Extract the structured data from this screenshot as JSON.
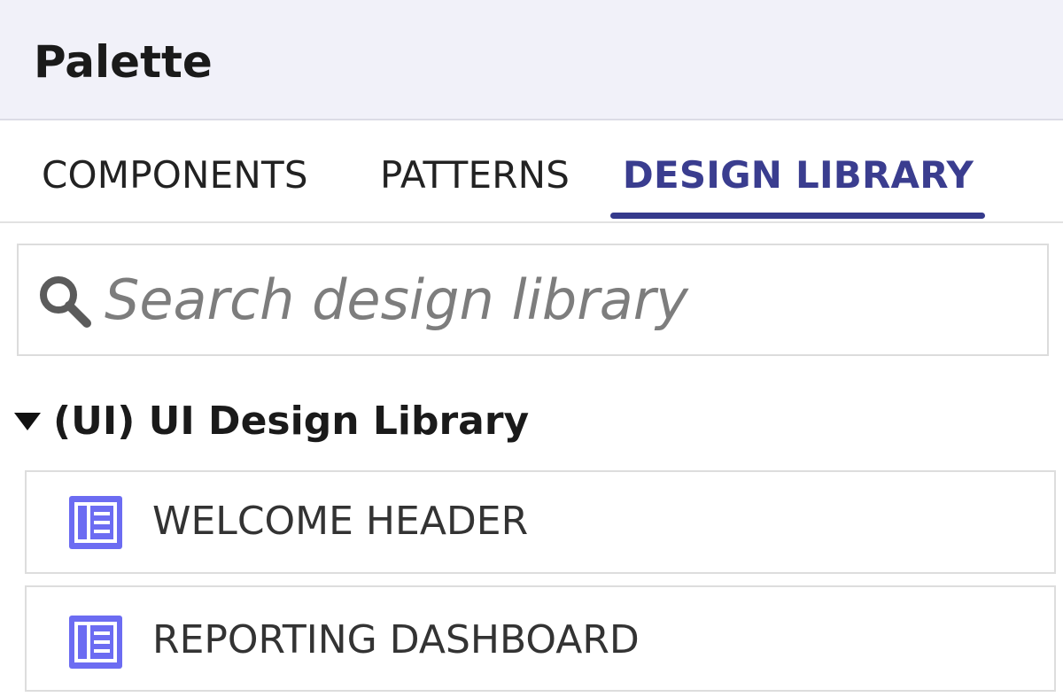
{
  "panel": {
    "title": "Palette"
  },
  "tabs": [
    {
      "label": "COMPONENTS",
      "active": false
    },
    {
      "label": "PATTERNS",
      "active": false
    },
    {
      "label": "DESIGN LIBRARY",
      "active": true
    }
  ],
  "search": {
    "placeholder": "Search design library",
    "value": "",
    "icon": "search-icon"
  },
  "library": {
    "group_label": "(UI) UI Design Library",
    "expanded": true,
    "items": [
      {
        "label": "WELCOME HEADER",
        "icon": "layout-icon"
      },
      {
        "label": "REPORTING DASHBOARD",
        "icon": "layout-icon"
      }
    ]
  },
  "colors": {
    "accent": "#353a8c",
    "header_bg": "#f1f1f9",
    "icon_blue": "#6c6cf2"
  }
}
